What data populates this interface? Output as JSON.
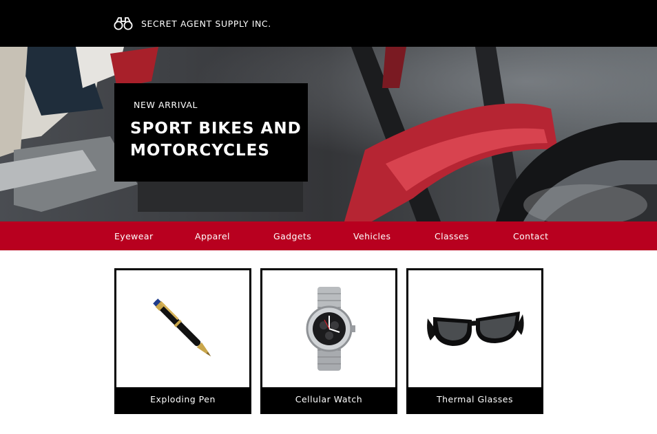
{
  "header": {
    "brand_name": "SECRET AGENT SUPPLY INC.",
    "logo_icon": "binoculars-icon"
  },
  "hero": {
    "eyebrow": "NEW ARRIVAL",
    "title": "SPORT BIKES AND MOTORCYCLES",
    "image": "motorcycle-photo"
  },
  "nav": {
    "items": [
      "Eyewear",
      "Apparel",
      "Gadgets",
      "Vehicles",
      "Classes",
      "Contact"
    ]
  },
  "products": [
    {
      "name": "Exploding Pen",
      "icon": "pen-icon"
    },
    {
      "name": "Cellular Watch",
      "icon": "watch-icon"
    },
    {
      "name": "Thermal Glasses",
      "icon": "sunglasses-icon"
    }
  ],
  "colors": {
    "topbar": "#000000",
    "nav_bg": "#b8001f",
    "card_bg": "#000000",
    "text_light": "#ffffff"
  }
}
